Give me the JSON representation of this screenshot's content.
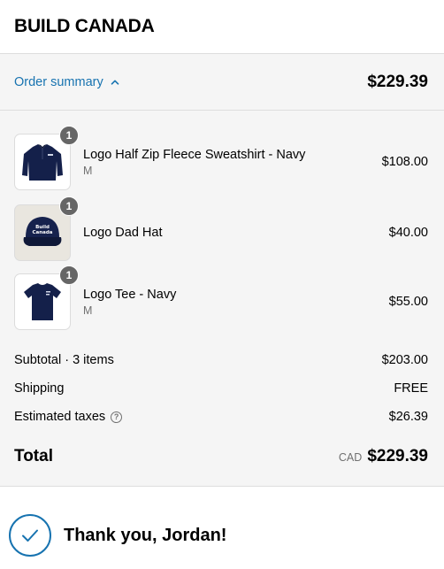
{
  "header": {
    "brand": "BUILD CANADA"
  },
  "summary": {
    "toggle_label": "Order summary",
    "total": "$229.39"
  },
  "items": [
    {
      "name": "Logo Half Zip Fleece Sweatshirt - Navy",
      "variant": "M",
      "price": "$108.00",
      "quantity": "1",
      "image": "sweatshirt-thumbnail"
    },
    {
      "name": "Logo Dad Hat",
      "variant": "",
      "price": "$40.00",
      "quantity": "1",
      "image": "hat-thumbnail",
      "hat_text_line1": "Build",
      "hat_text_line2": "Canada"
    },
    {
      "name": "Logo Tee - Navy",
      "variant": "M",
      "price": "$55.00",
      "quantity": "1",
      "image": "tee-thumbnail"
    }
  ],
  "totals": {
    "subtotal_label": "Subtotal · 3 items",
    "subtotal_value": "$203.00",
    "shipping_label": "Shipping",
    "shipping_value": "FREE",
    "taxes_label": "Estimated taxes",
    "taxes_help": "?",
    "taxes_value": "$26.39",
    "total_label": "Total",
    "currency": "CAD",
    "total_value": "$229.39"
  },
  "confirmation": {
    "message": "Thank you, Jordan!"
  },
  "colors": {
    "accent": "#1773b0",
    "panel": "#f5f5f5",
    "badge": "#666666",
    "navy": "#14204a"
  }
}
